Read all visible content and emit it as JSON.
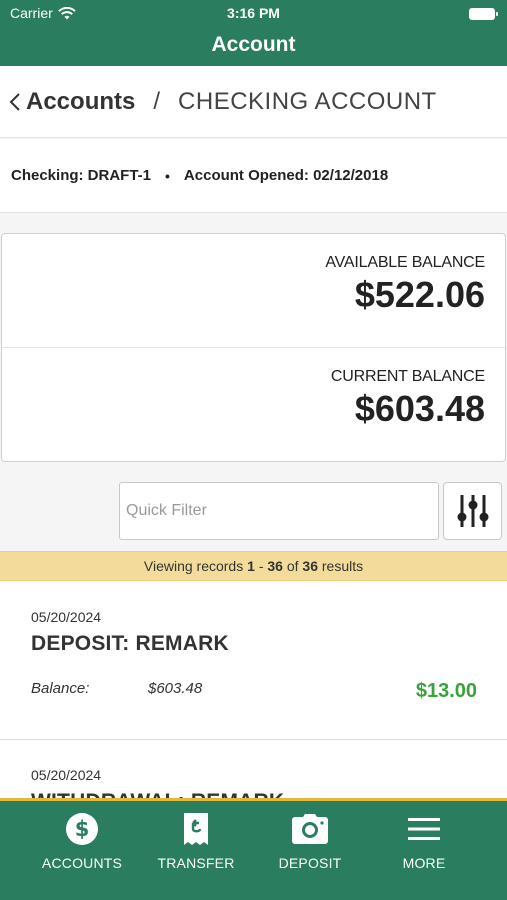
{
  "status_bar": {
    "carrier": "Carrier",
    "time": "3:16 PM"
  },
  "header": {
    "title": "Account"
  },
  "breadcrumb": {
    "parent": "Accounts",
    "separator": "/",
    "current": "CHECKING ACCOUNT"
  },
  "account_info": {
    "checking": "Checking: DRAFT-1",
    "bullet": "•",
    "opened": "Account Opened: 02/12/2018"
  },
  "balances": {
    "available_label": "AVAILABLE BALANCE",
    "available_amount": "$522.06",
    "current_label": "CURRENT BALANCE",
    "current_amount": "$603.48"
  },
  "filter": {
    "placeholder": "Quick Filter"
  },
  "records": {
    "prefix": "Viewing records",
    "start": "1",
    "dash": "-",
    "end": "36",
    "of": "of",
    "total": "36",
    "suffix": "results"
  },
  "transactions": [
    {
      "date": "05/20/2024",
      "description": "DEPOSIT: REMARK",
      "balance_label": "Balance:",
      "balance": "$603.48",
      "amount": "$13.00"
    },
    {
      "date": "05/20/2024",
      "description": "WITHDRAWAL: REMARK"
    }
  ],
  "tabs": [
    {
      "label": "ACCOUNTS",
      "icon": "dollar-circle-icon"
    },
    {
      "label": "TRANSFER",
      "icon": "transfer-receipt-icon"
    },
    {
      "label": "DEPOSIT",
      "icon": "camera-icon"
    },
    {
      "label": "MORE",
      "icon": "menu-icon"
    }
  ],
  "colors": {
    "brand_green": "#2a7d5f",
    "accent_gold": "#e2b93b",
    "records_bg": "#f3dc9b",
    "credit_green": "#3aa23a"
  }
}
